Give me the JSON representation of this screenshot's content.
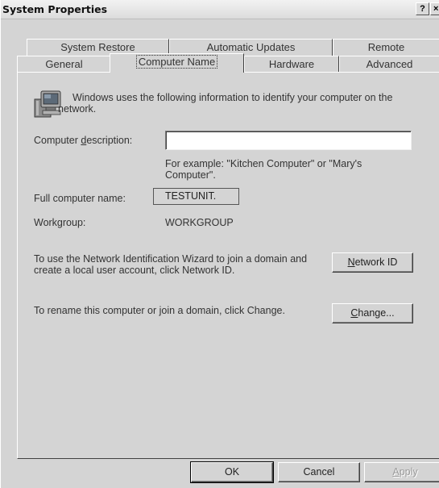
{
  "window": {
    "title": "System Properties",
    "help_label": "?",
    "close_label": "×"
  },
  "tabs_top": [
    {
      "label": "System Restore"
    },
    {
      "label": "Automatic Updates"
    },
    {
      "label": "Remote"
    }
  ],
  "tabs_bottom": [
    {
      "label": "General"
    },
    {
      "label": "Computer Name",
      "selected": true
    },
    {
      "label": "Hardware"
    },
    {
      "label": "Advanced"
    }
  ],
  "panel": {
    "intro_text": "Windows uses the following information to identify your computer on the network.",
    "description_label_pre": "Computer ",
    "description_label_key": "d",
    "description_label_post": "escription:",
    "description_value": "",
    "example_text": "For example: \"Kitchen Computer\" or \"Mary's Computer\".",
    "full_name_label": "Full computer name:",
    "full_name_value": "TESTUNIT.",
    "workgroup_label": "Workgroup:",
    "workgroup_value": "WORKGROUP",
    "network_id_text": "To use the Network Identification Wizard to join a domain and create a local user account, click Network ID.",
    "network_id_button_key": "N",
    "network_id_button_rest": "etwork ID",
    "rename_text": "To rename this computer or join a domain, click Change.",
    "change_button_key": "C",
    "change_button_rest": "hange..."
  },
  "footer": {
    "ok_label": "OK",
    "cancel_label": "Cancel",
    "apply_key": "A",
    "apply_rest": "pply"
  },
  "icons": {
    "computer": "computer-icon"
  }
}
